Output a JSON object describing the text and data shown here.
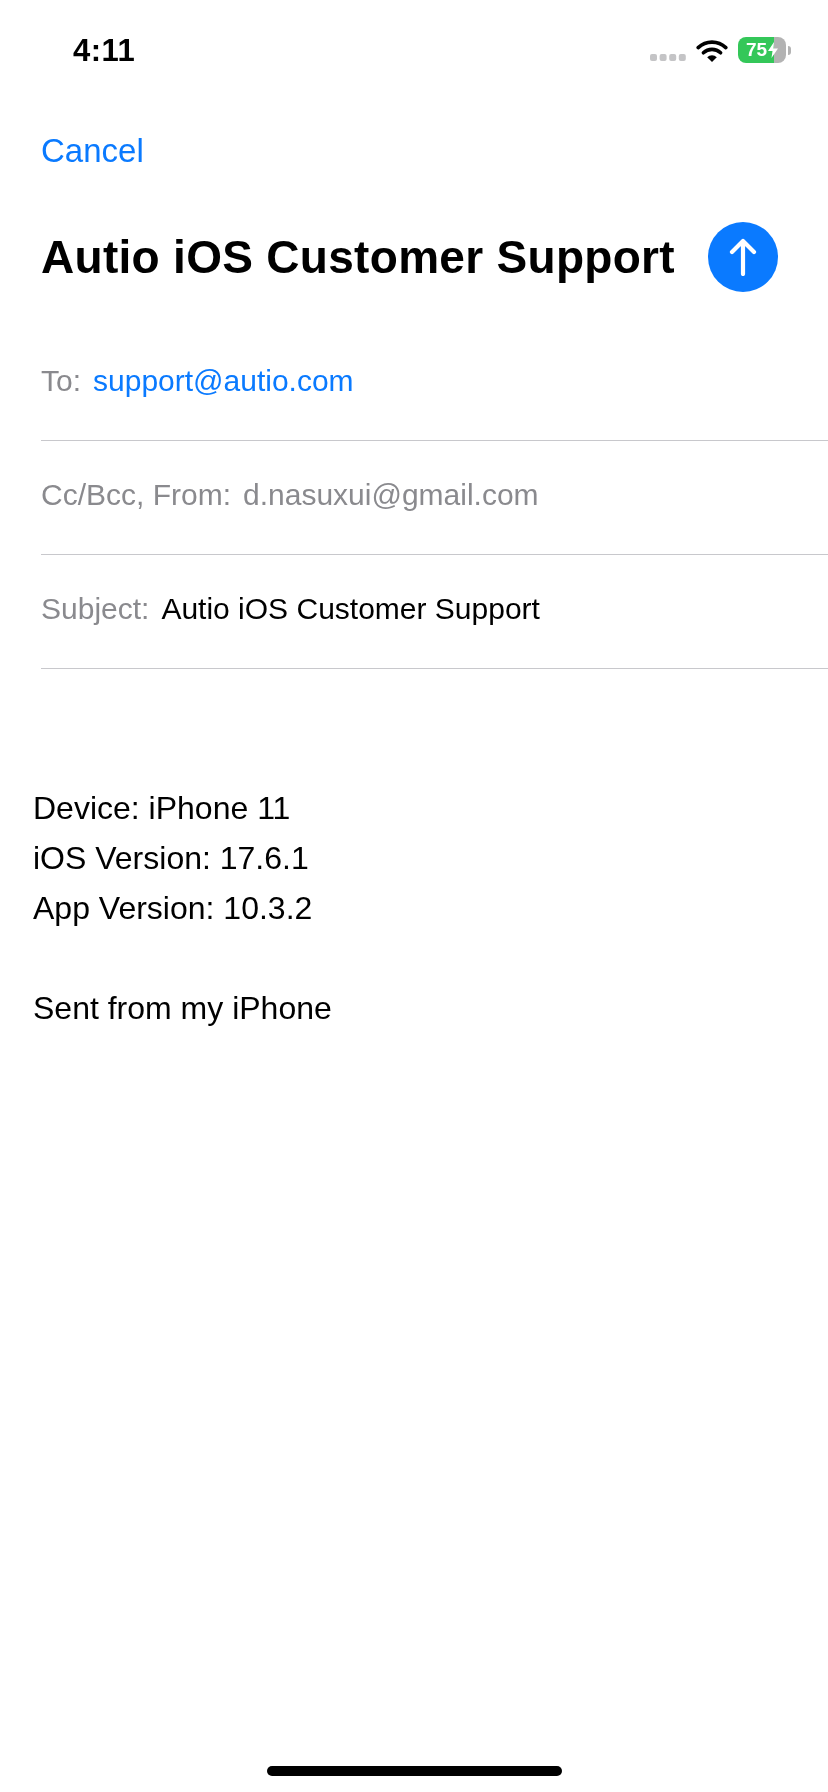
{
  "status_bar": {
    "time": "4:11",
    "battery_percent": "75",
    "charging": true
  },
  "header": {
    "cancel": "Cancel",
    "title": "Autio iOS Customer Support",
    "send_enabled": true
  },
  "fields": [
    {
      "kind": "recipient",
      "label": "To:",
      "value": "support@autio.com"
    },
    {
      "kind": "sender",
      "label": "Cc/Bcc, From:",
      "value": "d.nasuxui@gmail.com"
    },
    {
      "kind": "subject",
      "label": "Subject:",
      "value": "Autio iOS Customer Support"
    }
  ],
  "body": {
    "lines": [
      "Device: iPhone 11",
      "iOS Version: 17.6.1",
      "App Version: 10.3.2"
    ],
    "signature": "Sent from my iPhone"
  }
}
